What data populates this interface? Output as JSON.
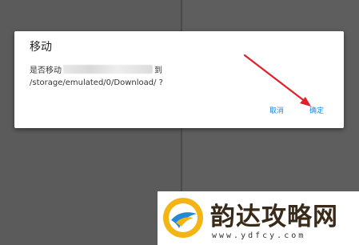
{
  "dialog": {
    "title": "移动",
    "message_prefix": "是否移动",
    "message_suffix": "到",
    "message_path": "/storage/emulated/0/Download/ ?",
    "cancel_label": "取消",
    "ok_label": "确定"
  },
  "annotation": {
    "arrow_color": "#e0202a"
  },
  "watermark": {
    "title": "韵达攻略网",
    "url": "www.ydfcy.com"
  },
  "colors": {
    "accent": "#1e88e5",
    "backdrop": "#5a5a5a"
  }
}
